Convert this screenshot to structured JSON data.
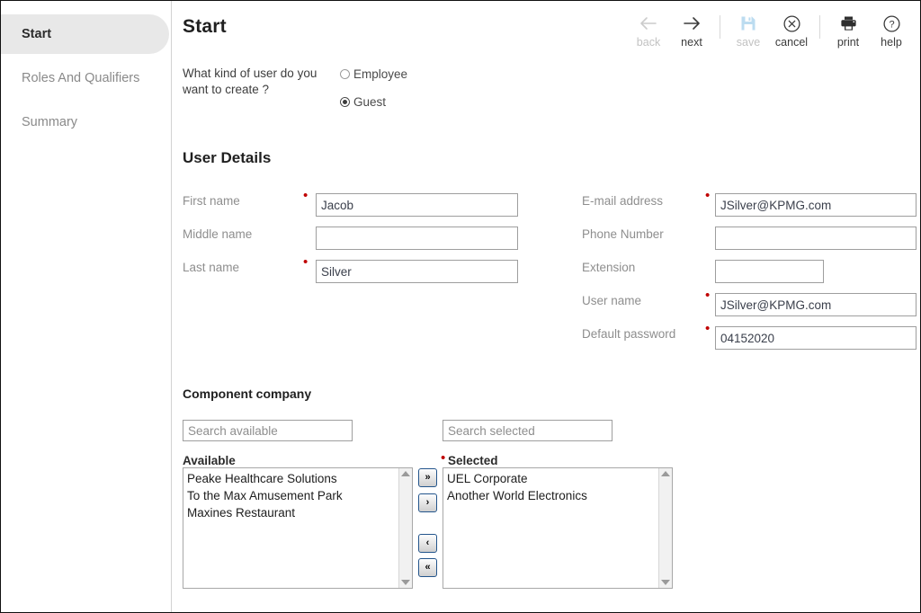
{
  "sidebar": {
    "items": [
      {
        "label": "Start",
        "active": true
      },
      {
        "label": "Roles And Qualifiers",
        "active": false
      },
      {
        "label": "Summary",
        "active": false
      }
    ]
  },
  "header": {
    "title": "Start"
  },
  "toolbar": {
    "buttons": [
      {
        "label": "back",
        "icon": "arrow-left-icon",
        "enabled": false
      },
      {
        "label": "next",
        "icon": "arrow-right-icon",
        "enabled": true
      },
      {
        "label": "save",
        "icon": "floppy-disk-icon",
        "enabled": false
      },
      {
        "label": "cancel",
        "icon": "circle-x-icon",
        "enabled": true
      },
      {
        "label": "print",
        "icon": "printer-icon",
        "enabled": true
      },
      {
        "label": "help",
        "icon": "question-circle-icon",
        "enabled": true
      }
    ]
  },
  "user_type": {
    "question": "What kind of user do you want to create  ?",
    "options": [
      {
        "label": "Employee",
        "selected": false
      },
      {
        "label": "Guest",
        "selected": true
      }
    ]
  },
  "user_details": {
    "heading": "User Details",
    "required_marker": "•",
    "fields": {
      "first_name": {
        "label": "First name",
        "value": "Jacob",
        "placeholder": "",
        "required": true
      },
      "middle_name": {
        "label": "Middle name",
        "value": "",
        "placeholder": "",
        "required": false
      },
      "last_name": {
        "label": "Last name",
        "value": "Silver",
        "placeholder": "",
        "required": true
      },
      "email": {
        "label": "E-mail address",
        "value": "JSilver@KPMG.com",
        "placeholder": "",
        "required": true
      },
      "phone": {
        "label": "Phone Number",
        "value": "",
        "placeholder": "",
        "required": false
      },
      "extension": {
        "label": "Extension",
        "value": "",
        "placeholder": "",
        "required": false
      },
      "user_name": {
        "label": "User name",
        "value": "JSilver@KPMG.com",
        "placeholder": "",
        "required": true
      },
      "default_password": {
        "label": "Default password",
        "value": "04152020",
        "placeholder": "",
        "required": true
      }
    }
  },
  "component_company": {
    "heading": "Component company",
    "search_available_placeholder": "Search available",
    "search_selected_placeholder": "Search selected",
    "available_label": "Available",
    "selected_label": "Selected",
    "available_items": [
      "Peake Healthcare Solutions",
      "To the Max Amusement Park",
      "Maxines Restaurant"
    ],
    "selected_items": [
      "UEL Corporate",
      "Another World Electronics"
    ],
    "transfer_buttons": {
      "all_right": "»",
      "right": "›",
      "left": "‹",
      "all_left": "«"
    }
  },
  "colors": {
    "required": "#c00000",
    "active_nav_bg": "#e8e8e8",
    "button_border": "#23558c",
    "label_grey": "#8e8e8e"
  }
}
